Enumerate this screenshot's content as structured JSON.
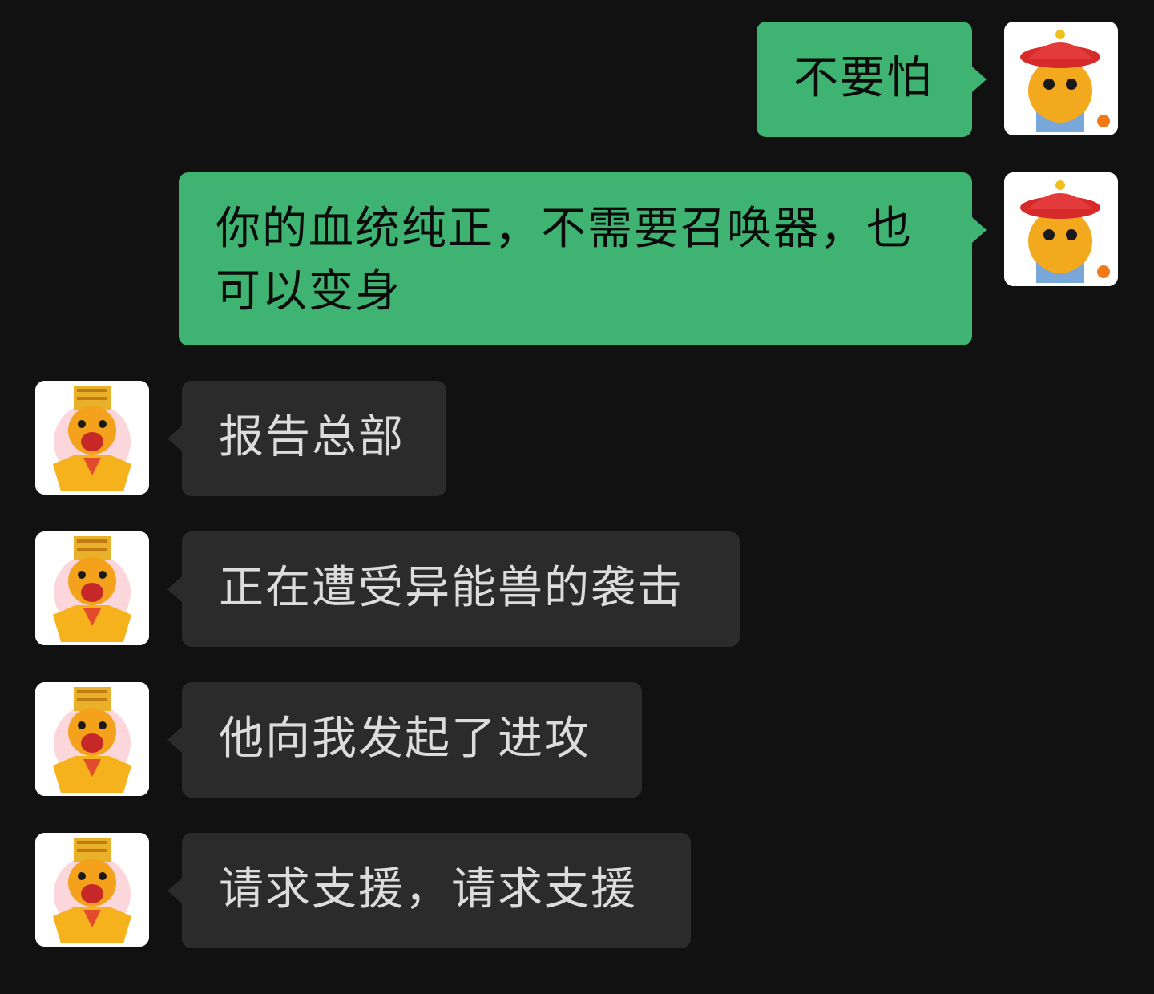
{
  "messages": [
    {
      "id": "m1",
      "side": "out",
      "avatar": "qing-official-hat-avatar",
      "text": "不要怕"
    },
    {
      "id": "m2",
      "side": "out",
      "avatar": "qing-official-hat-avatar",
      "text": "你的血统纯正，不需要召唤器，也可以变身"
    },
    {
      "id": "m3",
      "side": "in",
      "avatar": "emperor-crown-avatar",
      "text": "报告总部"
    },
    {
      "id": "m4",
      "side": "in",
      "avatar": "emperor-crown-avatar",
      "text": "正在遭受异能兽的袭击"
    },
    {
      "id": "m5",
      "side": "in",
      "avatar": "emperor-crown-avatar",
      "text": "他向我发起了进攻"
    },
    {
      "id": "m6",
      "side": "in",
      "avatar": "emperor-crown-avatar",
      "text": "请求支援，请求支援"
    }
  ],
  "colors": {
    "background": "#111111",
    "outgoing_bubble": "#3fb371",
    "incoming_bubble": "#2b2b2b",
    "outgoing_text": "#0b0b0b",
    "incoming_text": "#dcdcdc"
  }
}
